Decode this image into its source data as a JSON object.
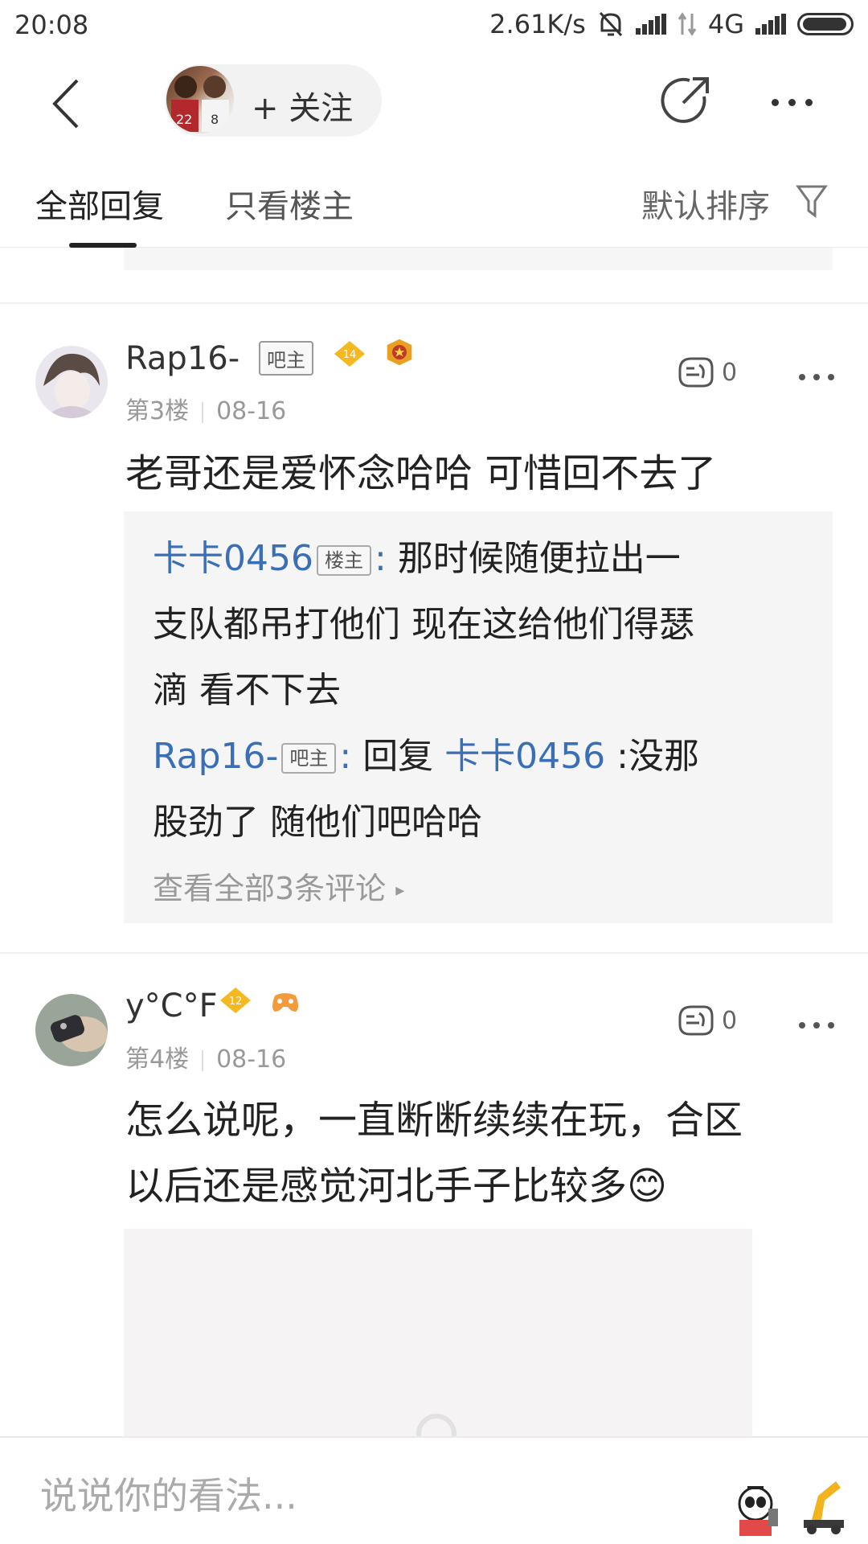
{
  "status_bar": {
    "time": "20:08",
    "net_speed": "2.61K/s",
    "network": "4G",
    "icons": [
      "mute-bell-icon",
      "signal-icon",
      "data-arrows-icon",
      "signal-icon",
      "battery-icon"
    ]
  },
  "top_nav": {
    "follow_label": "+ 关注",
    "icons": [
      "back-icon",
      "share-icon",
      "more-icon"
    ]
  },
  "tabs": {
    "all_replies": "全部回复",
    "only_op": "只看楼主",
    "sort_label": "默认排序"
  },
  "posts": [
    {
      "username": "Rap16-",
      "badge": "吧主",
      "level": "14",
      "floor": "第3楼",
      "date": "08-16",
      "likes": "0",
      "content": "老哥还是爱怀念哈哈 可惜回不去了",
      "replies": [
        {
          "name": "卡卡0456",
          "tag": "楼主",
          "line1": "那时候随便拉出一",
          "line2": "支队都吊打他们 现在这给他们得瑟",
          "line3": "滴 看不下去"
        },
        {
          "name": "Rap16-",
          "tag": "吧主",
          "prefix": "回复",
          "target": "卡卡0456",
          "line1": ":没那",
          "line2": "股劲了 随他们吧哈哈"
        }
      ],
      "view_all": "查看全部3条评论"
    },
    {
      "username": "y°C°F",
      "level": "12",
      "floor": "第4楼",
      "date": "08-16",
      "likes": "0",
      "content_line1": "怎么说呢，一直断断续续在玩，合区",
      "content_line2": "以后还是感觉河北手子比较多",
      "emoji": "😊"
    }
  ],
  "bottom_bar": {
    "placeholder": "说说你的看法..."
  },
  "colors": {
    "link_blue": "#3a6fb5",
    "gold_badge": "#f5b820",
    "reply_bg": "#f5f5f5"
  }
}
